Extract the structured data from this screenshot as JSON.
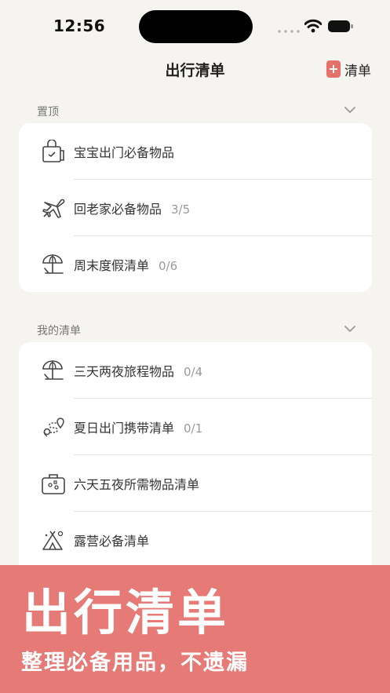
{
  "status_bar": {
    "time": "12:56"
  },
  "nav": {
    "title": "出行清单",
    "add_label": "清单",
    "add_icon_glyph": "+"
  },
  "sections": [
    {
      "title": "置顶",
      "items": [
        {
          "label": "宝宝出门必备物品",
          "count": "",
          "icon": "baby-bag-icon"
        },
        {
          "label": "回老家必备物品",
          "count": "3/5",
          "icon": "airplane-icon"
        },
        {
          "label": "周末度假清单",
          "count": "0/6",
          "icon": "beach-umbrella-icon"
        }
      ]
    },
    {
      "title": "我的清单",
      "items": [
        {
          "label": "三天两夜旅程物品",
          "count": "0/4",
          "icon": "beach-umbrella-icon"
        },
        {
          "label": "夏日出门携带清单",
          "count": "0/1",
          "icon": "route-pin-icon"
        },
        {
          "label": "六天五夜所需物品清单",
          "count": "",
          "icon": "suitcase-icon"
        },
        {
          "label": "露营必备清单",
          "count": "",
          "icon": "tent-icon"
        }
      ]
    }
  ],
  "banner": {
    "title": "出行清单",
    "subtitle": "整理必备用品，不遗漏"
  },
  "colors": {
    "accent": "#e5716b",
    "banner": "#e57a76",
    "background": "#f5f4f0"
  }
}
